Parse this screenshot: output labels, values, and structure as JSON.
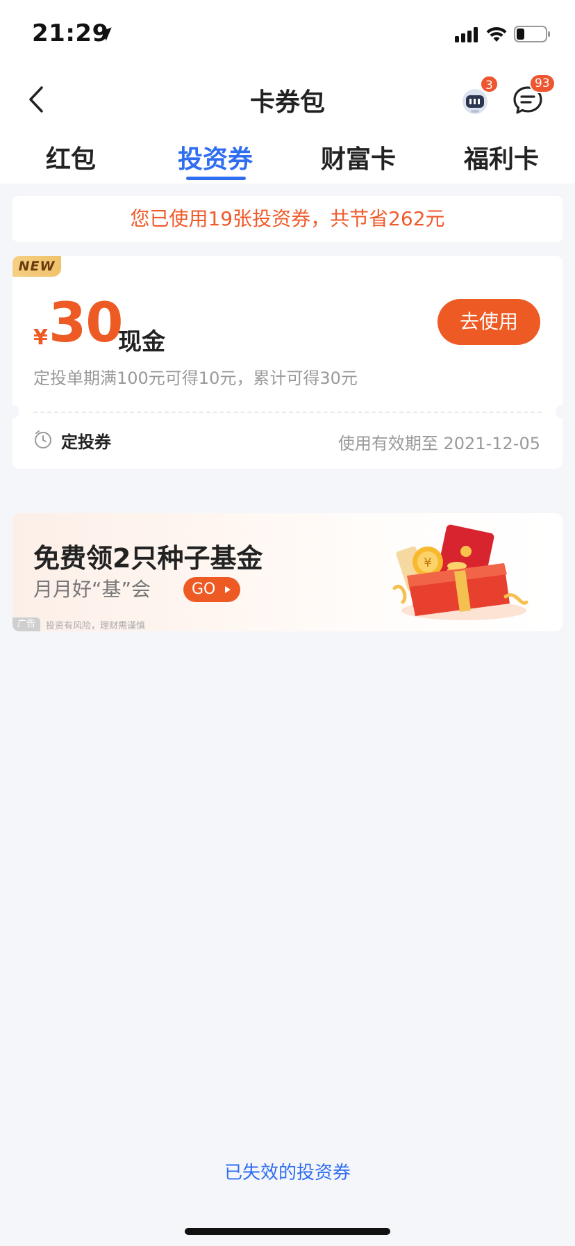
{
  "status_bar": {
    "time": "21:29",
    "icons": [
      "location-arrow-icon",
      "cellular-signal-icon",
      "wifi-icon",
      "battery-icon"
    ]
  },
  "nav": {
    "title": "卡券包",
    "robot_badge": "3",
    "message_badge": "93",
    "icons": [
      "back-chevron-icon",
      "robot-assistant-icon",
      "message-bubble-icon"
    ]
  },
  "tabs": [
    {
      "label": "红包",
      "active": false
    },
    {
      "label": "投资券",
      "active": true
    },
    {
      "label": "财富卡",
      "active": false
    },
    {
      "label": "福利卡",
      "active": false
    }
  ],
  "summary": {
    "text": "您已使用19张投资券，共节省262元"
  },
  "coupon": {
    "tag": "NEW",
    "currency": "¥",
    "amount": "30",
    "unit": "现金",
    "button": "去使用",
    "description": "定投单期满100元可得10元，累计可得30元",
    "type": "定投券",
    "expiry": "使用有效期至 2021-12-05"
  },
  "ad": {
    "title": "免费领2只种子基金",
    "subtitle": "月月好“基”会",
    "go_label": "GO",
    "tag": "广告",
    "disclaimer": "投资有风险，理财需谨慎"
  },
  "footer": {
    "expired_link": "已失效的投资券"
  },
  "colors": {
    "accent_blue": "#2f6df1",
    "accent_orange": "#ee5a24",
    "badge_red": "#ee5530",
    "background": "#f5f6fa"
  }
}
